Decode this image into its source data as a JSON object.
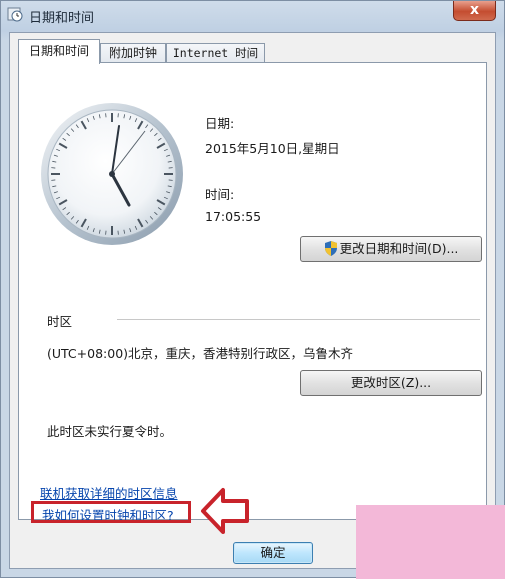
{
  "window": {
    "title": "日期和时间",
    "close_label": "x"
  },
  "tabs": [
    {
      "label": "日期和时间",
      "active": true
    },
    {
      "label": "附加时钟",
      "active": false
    },
    {
      "label": "Internet 时间",
      "active": false
    }
  ],
  "datetime": {
    "date_label": "日期:",
    "date_value": "2015年5月10日,星期日",
    "time_label": "时间:",
    "time_value": "17:05:55",
    "change_button": "更改日期和时间(D)..."
  },
  "timezone": {
    "section_label": "时区",
    "value": "(UTC+08:00)北京，重庆，香港特别行政区，乌鲁木齐",
    "change_button": "更改时区(Z)...",
    "dst_note": "此时区未实行夏令时。"
  },
  "links": {
    "online_info": "联机获取详细的时区信息",
    "how_to": "我如何设置时钟和时区?"
  },
  "footer": {
    "ok_button": "确定"
  },
  "colors": {
    "highlight": "#c8232b",
    "link": "#0645ad",
    "overlay": "#f3b8d8"
  },
  "icons": [
    "app-clock-icon",
    "close-icon",
    "uac-shield-icon",
    "analog-clock",
    "red-arrow-icon"
  ]
}
